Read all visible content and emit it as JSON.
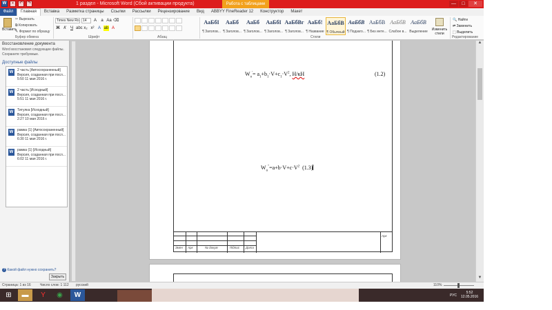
{
  "window": {
    "title": "1 раздел - Microsoft Word (Сбой активации продукта)",
    "context_tab": "Работа с таблицами",
    "qat_icons": [
      "word-logo",
      "save-icon",
      "undo-icon",
      "redo-icon"
    ],
    "controls": [
      "—",
      "□",
      "✕"
    ]
  },
  "tabs": [
    {
      "label": "Файл"
    },
    {
      "label": "Главная"
    },
    {
      "label": "Вставка"
    },
    {
      "label": "Разметка страницы"
    },
    {
      "label": "Ссылки"
    },
    {
      "label": "Рассылки"
    },
    {
      "label": "Рецензирование"
    },
    {
      "label": "Вид"
    },
    {
      "label": "ABBYY FineReader 12"
    },
    {
      "label": "Конструктор"
    },
    {
      "label": "Макет"
    }
  ],
  "ribbon": {
    "clipboard": {
      "paste": "Вставить",
      "cut": "Вырезать",
      "copy": "Копировать",
      "format_painter": "Формат по образцу",
      "group": "Буфер обмена"
    },
    "font": {
      "name": "Times New Ro",
      "size": "14",
      "group": "Шрифт"
    },
    "paragraph_group": "Абзац",
    "styles_group": "Стили",
    "styles": [
      {
        "sample": "AaБбI",
        "name": "¶ Заголов..."
      },
      {
        "sample": "AaБб",
        "name": "¶ Заголов..."
      },
      {
        "sample": "AaБб",
        "name": "¶ Заголов..."
      },
      {
        "sample": "AaБбI",
        "name": "¶ Заголов..."
      },
      {
        "sample": "AaБбВг",
        "name": "¶ Заголов..."
      },
      {
        "sample": "AaБб!",
        "name": "¶ Название"
      },
      {
        "sample": "AaБбВ",
        "name": "¶ Обычный"
      },
      {
        "sample": "AaБбВ",
        "name": "¶ Подзаго..."
      },
      {
        "sample": "AaБбВ",
        "name": "¶ Без инте..."
      },
      {
        "sample": "AaБбВ",
        "name": "Слабое в..."
      },
      {
        "sample": "AaБбВ",
        "name": "Выделение"
      }
    ],
    "change_styles": "Изменить стили",
    "editing": {
      "find": "Найти",
      "replace": "Заменить",
      "select": "Выделить",
      "group": "Редактирование"
    }
  },
  "recovery_pane": {
    "title": "Восстановление документа",
    "description": "Word восстановил следующие файлы. Сохраните требуемые.",
    "available": "Доступные файлы",
    "files": [
      {
        "name": "2 часть  [Автосохраненный]",
        "desc": "Версия, созданная при посл...",
        "time": "5:50 11 мая 2016 г."
      },
      {
        "name": "2 часть  [Исходный]",
        "desc": "Версия, созданная при посл...",
        "time": "5:51 11 мая 2016 г."
      },
      {
        "name": "Титулка  [Исходный]",
        "desc": "Версия, созданная при посл...",
        "time": "2:27 10 мая 2016 г."
      },
      {
        "name": "рамка (1)  [Автосохраненный]",
        "desc": "Версия, созданная при посл...",
        "time": "6:30 11 мая 2016 г."
      },
      {
        "name": "рамка (1)  [Исходный]",
        "desc": "Версия, созданная при посл...",
        "time": "6:02 11 мая 2016 г."
      }
    ],
    "help_link": "Какой файл нужно сохранить?",
    "close": "Закрыть"
  },
  "document": {
    "formula1_num": "(1.2)",
    "formula1_unit": "Н/кН",
    "formula2_num": "(1.3)",
    "stamp": {
      "cols": [
        "Змен",
        "Арк",
        "№ докум",
        "Підпис",
        "Дата"
      ],
      "sheet": "Арк"
    }
  },
  "statusbar": {
    "page": "Страница: 1 из 16",
    "words": "Число слов: 1 112",
    "lang": "русский",
    "zoom": "110%"
  },
  "taskbar": {
    "lang": "РУС",
    "time": "5:52",
    "date": "12.05.2016"
  }
}
